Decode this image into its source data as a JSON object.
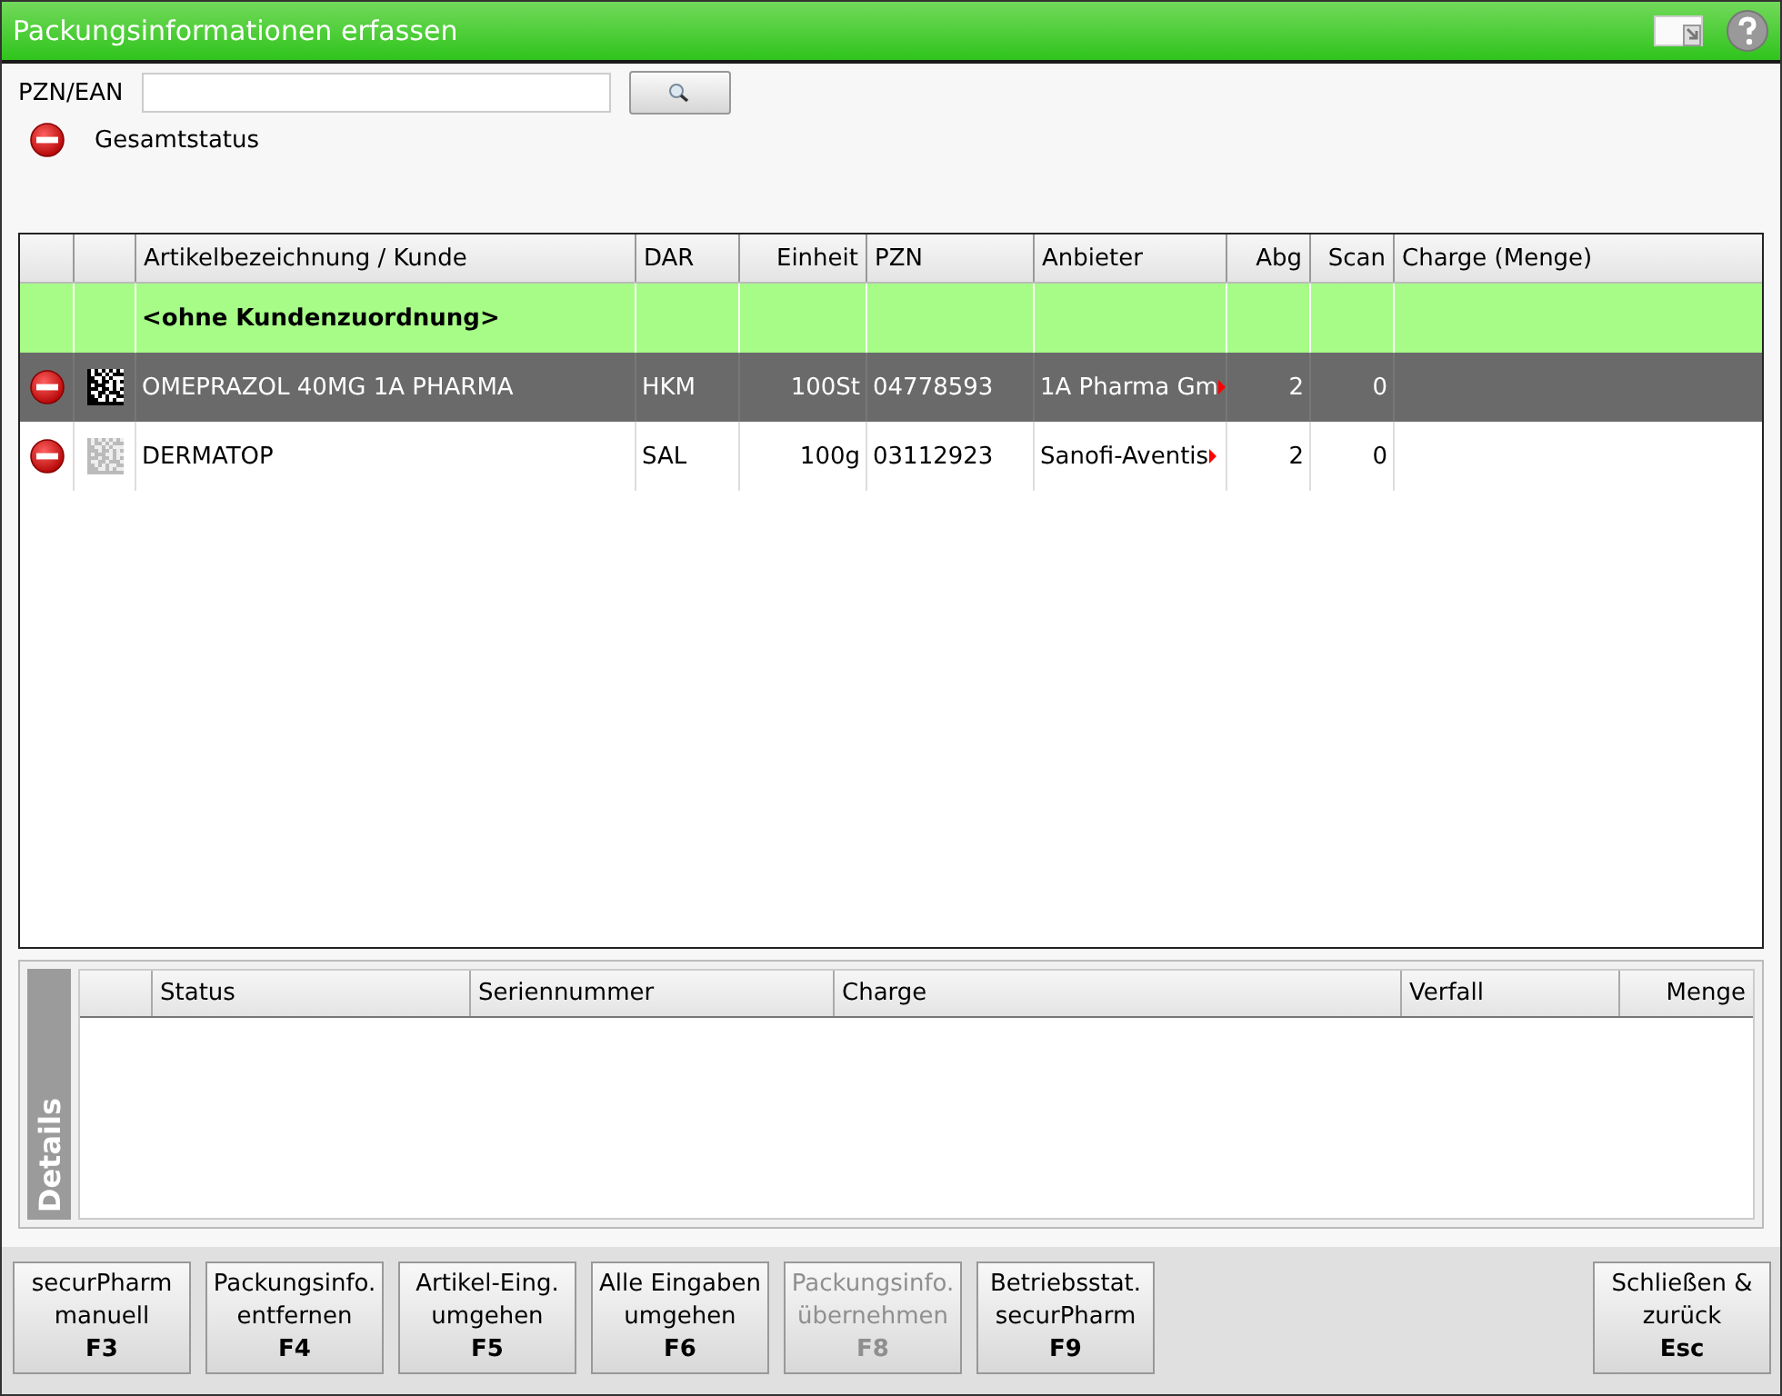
{
  "window": {
    "title": "Packungsinformationen erfassen"
  },
  "search": {
    "label": "PZN/EAN"
  },
  "overall_status": {
    "label": "Gesamtstatus"
  },
  "table": {
    "columns": [
      "Artikelbezeichnung / Kunde",
      "DAR",
      "Einheit",
      "PZN",
      "Anbieter",
      "Abg",
      "Scan",
      "Charge (Menge)"
    ],
    "rows": [
      {
        "kind": "group",
        "label": "<ohne Kundenzuordnung>"
      },
      {
        "kind": "item",
        "selected": true,
        "name": "OMEPRAZOL 40MG 1A PHARMA",
        "dar": "HKM",
        "unit": "100St",
        "pzn": "04778593",
        "supplier": "1A Pharma Gm",
        "supplier_cut": true,
        "abg": "2",
        "scan": "0"
      },
      {
        "kind": "item",
        "selected": false,
        "name": "DERMATOP",
        "dar": "SAL",
        "unit": "100g",
        "pzn": "03112923",
        "supplier": "Sanofi-Aventis",
        "supplier_cut": true,
        "abg": "2",
        "scan": "0"
      }
    ]
  },
  "details": {
    "title": "Details",
    "columns": [
      "Status",
      "Seriennummer",
      "Charge",
      "Verfall",
      "Menge"
    ]
  },
  "buttons": [
    {
      "label": "securPharm",
      "label2": "manuell",
      "key": "F3",
      "disabled": false
    },
    {
      "label": "Packungsinfo.",
      "label2": "entfernen",
      "key": "F4",
      "disabled": false
    },
    {
      "label": "Artikel-Eing.",
      "label2": "umgehen",
      "key": "F5",
      "disabled": false
    },
    {
      "label": "Alle Eingaben",
      "label2": "umgehen",
      "key": "F6",
      "disabled": false
    },
    {
      "label": "Packungsinfo.",
      "label2": "übernehmen",
      "key": "F8",
      "disabled": true
    },
    {
      "label": "Betriebsstat.",
      "label2": "securPharm",
      "key": "F9",
      "disabled": false
    }
  ],
  "close_button": {
    "label": "Schließen &",
    "label2": "zurück",
    "key": "Esc",
    "disabled": false
  }
}
